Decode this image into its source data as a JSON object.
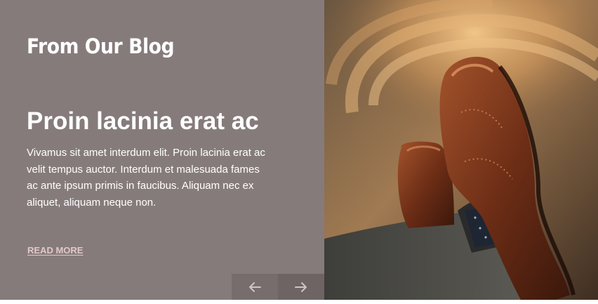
{
  "blog": {
    "section_title": "From Our Blog",
    "post": {
      "title": "Proin lacinia erat ac",
      "excerpt": "Vivamus sit amet interdum elit. Proin lacinia erat ac velit tempus auctor. Interdum et malesuada fames ac ante ipsum primis in faucibus. Aliquam nec ex aliquet, aliquam neque non.",
      "read_more_label": "READ MORE"
    },
    "navigation": {
      "prev_icon": "arrow-left-icon",
      "next_icon": "arrow-right-icon"
    },
    "image": {
      "subject": "crossed legs in brown leather brogue shoes"
    }
  },
  "colors": {
    "panel_background": "#867b7b",
    "nav_prev_background": "#776d6d",
    "nav_next_background": "#6e6464",
    "read_more_link": "#e2c8c8",
    "text": "#ffffff"
  }
}
